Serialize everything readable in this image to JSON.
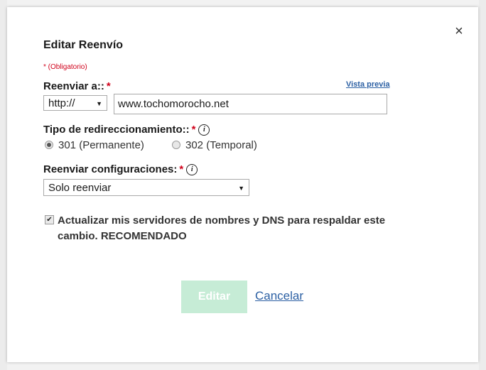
{
  "dialog": {
    "title": "Editar Reenvío",
    "close_icon": "×",
    "required_note": "* (Obligatorio)"
  },
  "forward_to": {
    "label": "Reenviar a::",
    "star": "*",
    "preview_link": "Vista previa",
    "protocol": {
      "selected": "http://",
      "arrow": "▼"
    },
    "url_value": "www.tochomorocho.net"
  },
  "redirect_type": {
    "label": "Tipo de redireccionamiento::",
    "star": "*",
    "info": "i",
    "options": [
      {
        "label": "301 (Permanente)",
        "checked": true
      },
      {
        "label": "302 (Temporal)",
        "checked": false
      }
    ]
  },
  "forward_settings": {
    "label": "Reenviar configuraciones:",
    "star": "*",
    "info": "i",
    "selected": "Solo reenviar",
    "arrow": "▼"
  },
  "update_dns": {
    "checked": true,
    "check_glyph": "✔",
    "label": "Actualizar mis servidores de nombres y DNS para respaldar este cambio. RECOMENDADO"
  },
  "buttons": {
    "primary": "Editar",
    "cancel": "Cancelar"
  },
  "colors": {
    "required_red": "#d0021b",
    "link_blue": "#2b5fa3",
    "primary_disabled_green": "#c6ecd6"
  }
}
